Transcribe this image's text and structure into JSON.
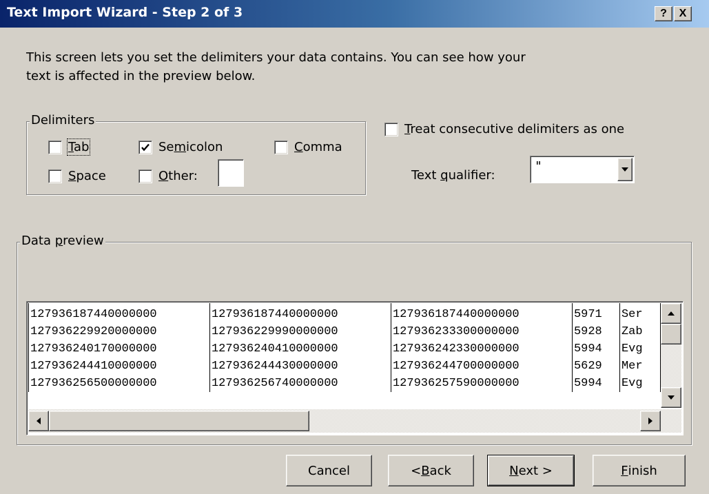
{
  "window": {
    "title": "Text Import Wizard - Step 2 of 3",
    "help_label": "?",
    "close_label": "X"
  },
  "intro_text": "This screen lets you set the delimiters your data contains.  You can see how your text is affected in the preview below.",
  "delimiters": {
    "group_label": "Delimiters",
    "tab": {
      "label": "Tab",
      "checked": false
    },
    "semicolon": {
      "label": "Semicolon",
      "checked": true
    },
    "comma": {
      "label": "Comma",
      "checked": false
    },
    "space": {
      "label": "Space",
      "checked": false
    },
    "other": {
      "label": "Other:",
      "checked": false,
      "value": ""
    }
  },
  "treat_consecutive": {
    "label": "Treat consecutive delimiters as one",
    "checked": false
  },
  "text_qualifier": {
    "label": "Text qualifier:",
    "value": "\""
  },
  "data_preview": {
    "group_label": "Data preview",
    "rows": [
      [
        "127936187440000000",
        "127936187440000000",
        "127936187440000000",
        "5971",
        "Ser"
      ],
      [
        "127936229920000000",
        "127936229990000000",
        "127936233300000000",
        "5928",
        "Zab"
      ],
      [
        "127936240170000000",
        "127936240410000000",
        "127936242330000000",
        "5994",
        "Evg"
      ],
      [
        "127936244410000000",
        "127936244430000000",
        "127936244700000000",
        "5629",
        "Mer"
      ],
      [
        "127936256500000000",
        "127936256740000000",
        "127936257590000000",
        "5994",
        "Evg"
      ]
    ]
  },
  "buttons": {
    "cancel": "Cancel",
    "back": "< Back",
    "next": "Next >",
    "finish": "Finish"
  }
}
